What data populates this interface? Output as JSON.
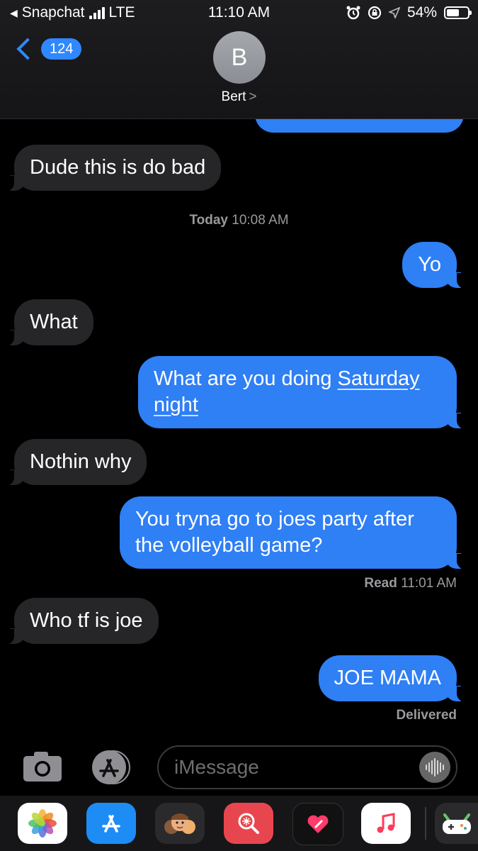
{
  "status_bar": {
    "back_app": "Snapchat",
    "network": "LTE",
    "time": "11:10 AM",
    "battery": "54%",
    "battery_level": 0.54
  },
  "header": {
    "back_badge": "124",
    "avatar_initial": "B",
    "contact_name": "Bert",
    "chevron": ">"
  },
  "conversation": {
    "messages": [
      {
        "direction": "incoming",
        "text": "Dude this is do bad"
      },
      {
        "direction": "outgoing",
        "text": "Yo"
      },
      {
        "direction": "incoming",
        "text": "What"
      },
      {
        "direction": "outgoing",
        "text_before": "What are you doing ",
        "link_text": "Saturday",
        "link_text_2": "night"
      },
      {
        "direction": "incoming",
        "text": "Nothin why"
      },
      {
        "direction": "outgoing",
        "text": "You tryna go to joes party after the volleyball game?"
      },
      {
        "direction": "incoming",
        "text": "Who tf is joe"
      },
      {
        "direction": "outgoing",
        "text": "JOE MAMA"
      }
    ],
    "timestamp": {
      "day": "Today",
      "time": "10:08 AM"
    },
    "read_receipt": {
      "label": "Read",
      "time": "11:01 AM"
    },
    "delivered": "Delivered"
  },
  "composer": {
    "placeholder": "iMessage"
  },
  "app_drawer": {
    "apps": [
      "photos-icon",
      "app-store-icon",
      "memoji-icon",
      "search-images-icon",
      "digital-touch-icon",
      "music-icon",
      "game-icon"
    ]
  },
  "colors": {
    "outgoing": "#2f7ff5",
    "incoming": "#262628",
    "accent": "#2f88ff"
  }
}
